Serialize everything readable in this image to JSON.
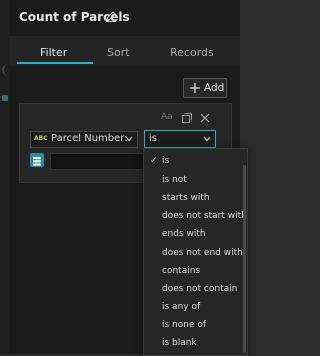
{
  "header": {
    "title": "Count of Parcels",
    "edit_icon": "pencil-icon"
  },
  "tabs": [
    {
      "label": "Filter",
      "active": true
    },
    {
      "label": "Sort",
      "active": false
    },
    {
      "label": "Records",
      "active": false
    }
  ],
  "add_button": {
    "label": "Add",
    "icon": "plus-icon"
  },
  "clause": {
    "field_type_badge": "ABC",
    "field_label": "Parcel Number:",
    "operator_value": "is",
    "toolbar_icons": [
      "case-sensitive-icon",
      "copy-icon",
      "close-icon"
    ],
    "value": ""
  },
  "dropdown": {
    "selected": "is",
    "options": [
      "is",
      "is not",
      "starts with",
      "does not start with",
      "ends with",
      "does not end with",
      "contains",
      "does not contain",
      "is any of",
      "is none of",
      "is blank"
    ]
  },
  "colors": {
    "accent": "#2ab0c6",
    "panel": "#1b1b1b",
    "card": "#262626"
  }
}
